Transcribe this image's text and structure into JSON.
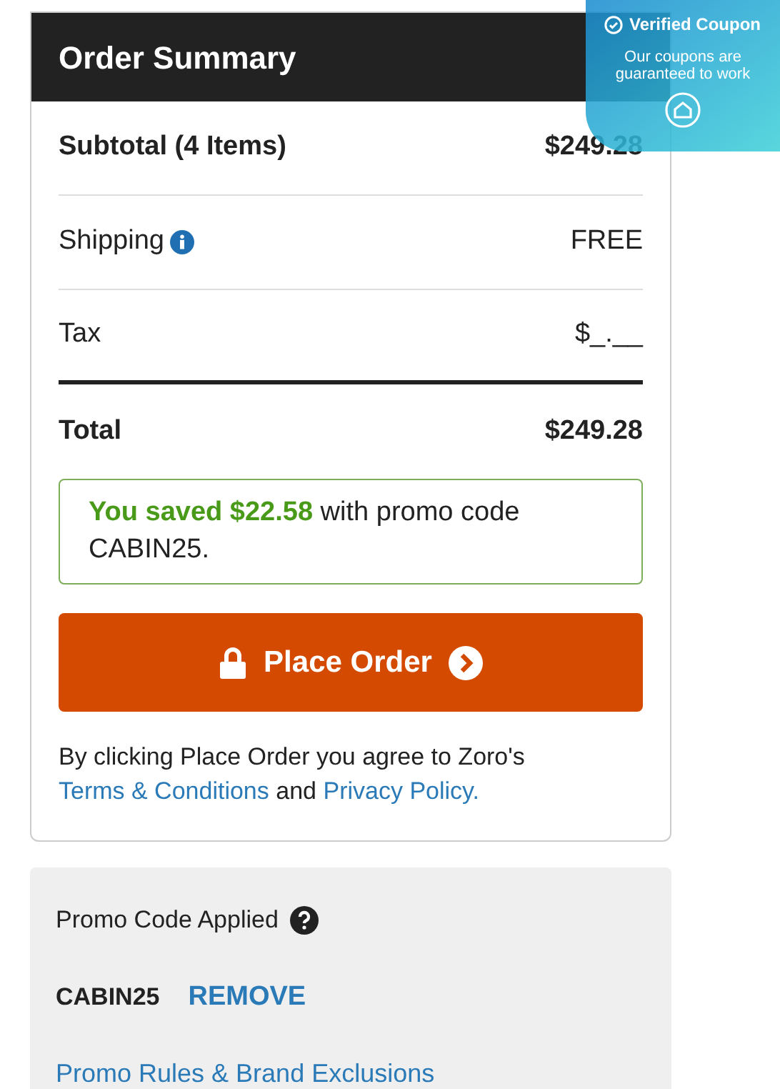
{
  "summary": {
    "title": "Order Summary",
    "rows": [
      {
        "kind": "subtotal",
        "label": "Subtotal (4 Items)",
        "value": "$249.28",
        "info": false
      },
      {
        "kind": "line",
        "label": "Shipping",
        "value": "FREE",
        "info": true
      },
      {
        "kind": "line",
        "label": "Tax",
        "value": "$_.__",
        "info": false
      },
      {
        "kind": "total",
        "label": "Total",
        "value": "$249.28",
        "info": false
      }
    ],
    "savings": "**You saved $22.58** with promo code CABIN25.",
    "place_order": "Place Order",
    "agreement": {
      "text": "By clicking Place Order you agree to Zoro's",
      "terms_link": "Terms & Conditions",
      "joiner": "and",
      "privacy_link": "Privacy Policy."
    }
  },
  "promo": {
    "title": "Promo Code Applied",
    "code": "CABIN25",
    "remove": "REMOVE",
    "rules_link": "Promo Rules & Brand Exclusions"
  },
  "coupon_badge": {
    "title": "Verified Coupon",
    "subtitle": "Our coupons are guaranteed to work"
  }
}
